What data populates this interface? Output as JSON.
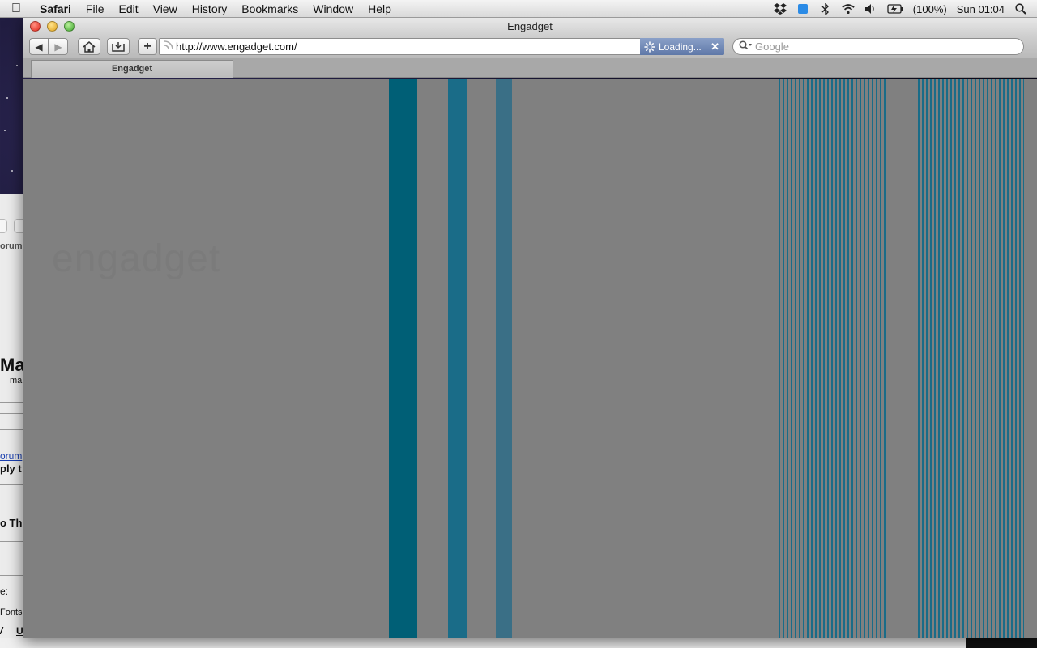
{
  "menubar": {
    "app_name": "Safari",
    "items": [
      "File",
      "Edit",
      "View",
      "History",
      "Bookmarks",
      "Window",
      "Help"
    ],
    "battery_text": "(100%)",
    "clock": "Sun 01:04",
    "icons": [
      "apple-icon",
      "dropbox-icon",
      "app-status-icon",
      "bluetooth-icon",
      "wifi-icon",
      "volume-icon",
      "battery-icon",
      "spotlight-icon"
    ]
  },
  "window": {
    "title": "Engadget",
    "url": "http://www.engadget.com/",
    "loading_label": "Loading...",
    "search_placeholder": "Google",
    "tab_label": "Engadget",
    "page_faint_text": "engadget"
  },
  "background_window": {
    "texts": [
      "orum",
      "Mac",
      "ma",
      "orum",
      "ply t",
      "o Th",
      "e:",
      "Fonts",
      "/",
      "U"
    ]
  },
  "colors": {
    "glitch": "#0f6b82",
    "content_bg": "#808080"
  }
}
